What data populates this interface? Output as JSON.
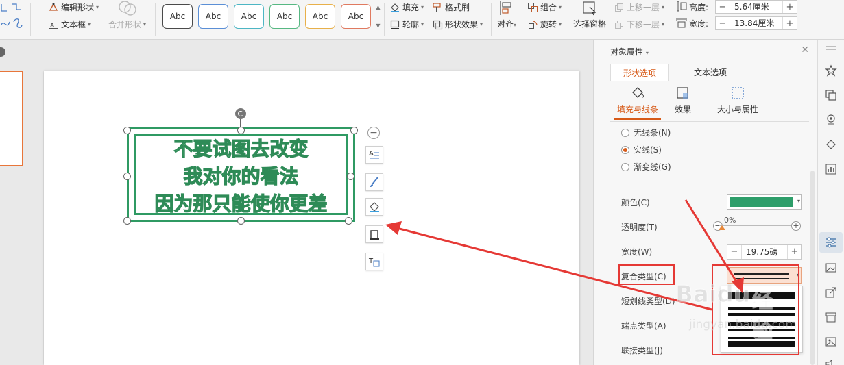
{
  "ribbon": {
    "edit_shape": "编辑形状",
    "text_box": "文本框",
    "merge_shape": "合并形状",
    "styles": [
      "Abc",
      "Abc",
      "Abc",
      "Abc",
      "Abc",
      "Abc"
    ],
    "style_colors": [
      "#4a4a4a",
      "#5b8fd6",
      "#4db6c4",
      "#57b883",
      "#e8b04a",
      "#e07a60"
    ],
    "fill": "填充",
    "outline": "轮廓",
    "format_painter": "格式刷",
    "shape_effect": "形状效果",
    "align": "对齐",
    "group": "组合",
    "rotate": "旋转",
    "selection_pane": "选择窗格",
    "bring_forward": "上移一层",
    "send_backward": "下移一层",
    "height_label": "高度:",
    "height_value": "5.64厘米",
    "width_label": "宽度:",
    "width_value": "13.84厘米"
  },
  "canvas": {
    "shape_text": [
      "不要试图去改变",
      "我对你的看法",
      "因为那只能使你更差"
    ],
    "shape_color": "#2f9a63"
  },
  "panel": {
    "title": "对象属性",
    "tabs": [
      "形状选项",
      "文本选项"
    ],
    "subtabs": [
      "填充与线条",
      "效果",
      "大小与属性"
    ],
    "line_options": [
      "无线条(N)",
      "实线(S)",
      "渐变线(G)"
    ],
    "color_label": "颜色(C)",
    "color_value": "#2e9e6a",
    "transparency_label": "透明度(T)",
    "transparency_value": "0%",
    "width_label": "宽度(W)",
    "width_value": "19.75磅",
    "compound_label": "复合类型(C)",
    "dash_label": "短划线类型(D)",
    "cap_label": "端点类型(A)",
    "join_label": "联接类型(J)"
  },
  "watermark": {
    "brand": "Baidu",
    "brand_cn": "经验",
    "url": "jingyan.baidu.com"
  },
  "colors": {
    "accent": "#d75a18",
    "annotation_red": "#e53935"
  }
}
